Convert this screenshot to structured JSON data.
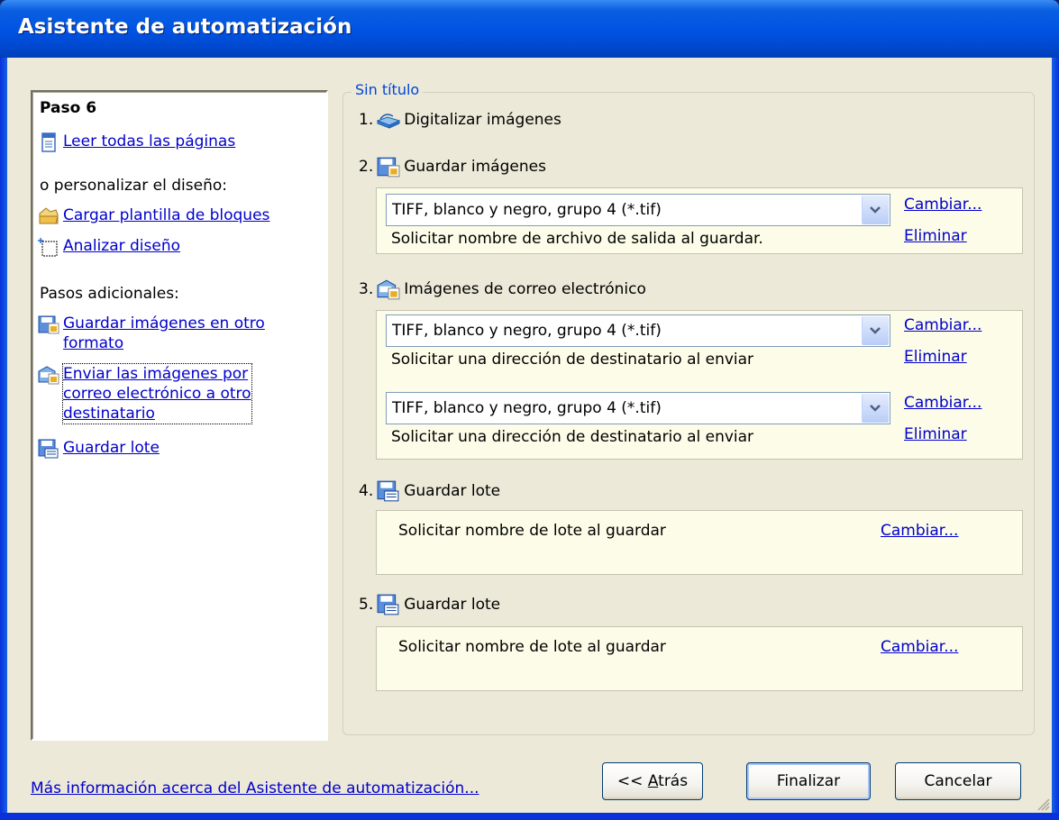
{
  "window": {
    "title": "Asistente de automatización"
  },
  "left_pane": {
    "heading": "Paso 6",
    "read_all": "Leer todas las páginas",
    "or_customize": "o personalizar el diseño:",
    "load_template": "Cargar plantilla de bloques",
    "analyze_layout": "Analizar diseño",
    "additional_steps": "Pasos adicionales:",
    "save_images_other_line1": "Guardar imágenes en otro",
    "save_images_other_line2": "formato",
    "send_email_line1": "Enviar las imágenes por",
    "send_email_line2": "correo electrónico a otro",
    "send_email_line3": "destinatario",
    "save_batch": "Guardar lote"
  },
  "group": {
    "title": "Sin título"
  },
  "steps": [
    {
      "num": "1.",
      "label": "Digitalizar imágenes",
      "icon": "scanner-icon"
    },
    {
      "num": "2.",
      "label": "Guardar imágenes",
      "icon": "save-image-icon"
    },
    {
      "num": "3.",
      "label": "Imágenes de correo electrónico",
      "icon": "email-image-icon"
    },
    {
      "num": "4.",
      "label": "Guardar lote",
      "icon": "save-batch-icon"
    },
    {
      "num": "5.",
      "label": "Guardar lote",
      "icon": "save-batch-icon"
    }
  ],
  "step2_panel": {
    "format": "TIFF, blanco y negro, grupo 4 (*.tif)",
    "note": "Solicitar nombre de archivo de salida al guardar.",
    "change": "Cambiar...",
    "remove": "Eliminar"
  },
  "step3_panel": {
    "entries": [
      {
        "format": "TIFF, blanco y negro, grupo 4 (*.tif)",
        "note": "Solicitar una dirección de destinatario al enviar",
        "change": "Cambiar...",
        "remove": "Eliminar"
      },
      {
        "format": "TIFF, blanco y negro, grupo 4 (*.tif)",
        "note": "Solicitar una dirección de destinatario al enviar",
        "change": "Cambiar...",
        "remove": "Eliminar"
      }
    ]
  },
  "step4_panel": {
    "note": "Solicitar nombre de lote al guardar",
    "change": "Cambiar..."
  },
  "step5_panel": {
    "note": "Solicitar nombre de lote al guardar",
    "change": "Cambiar..."
  },
  "footer": {
    "more_info": "Más información acerca del Asistente de automatización...",
    "back_prefix": "<< ",
    "back_accel": "A",
    "back_rest": "trás",
    "finish": "Finalizar",
    "cancel": "Cancelar"
  },
  "colors": {
    "title_bar": "#0054e3",
    "face": "#ece9d8",
    "panel": "#fcfce8",
    "link": "#0000cc",
    "group_title": "#0046d5"
  }
}
